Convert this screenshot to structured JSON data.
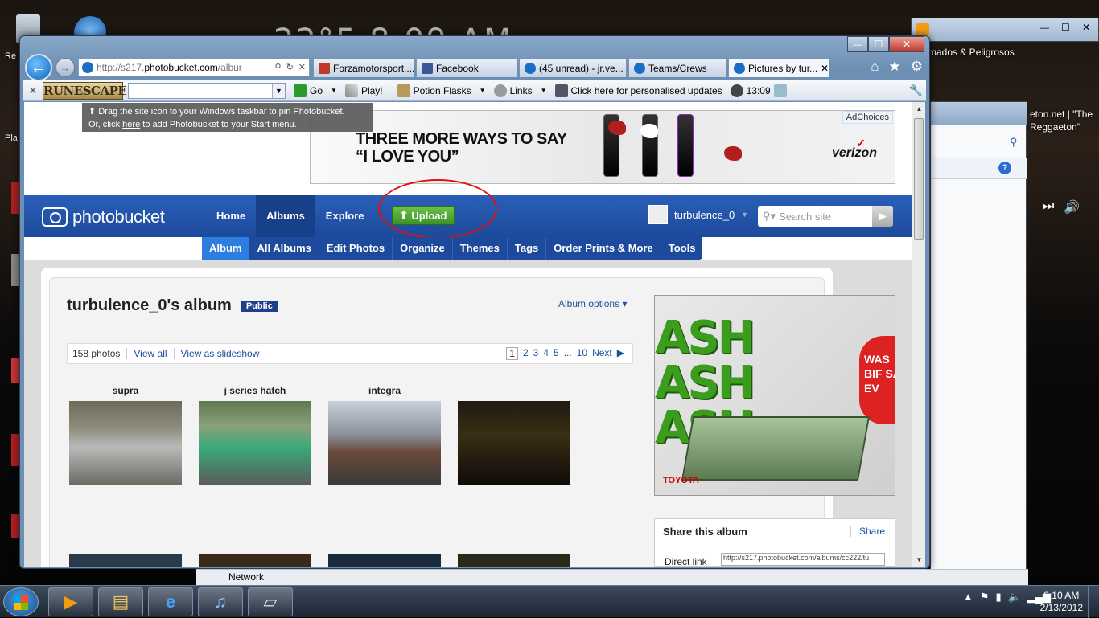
{
  "desktop": {
    "clock_text": "22°5   8:09 AM",
    "icons": [
      {
        "label": "Re",
        "name": "recycle-bin"
      },
      {
        "label": "Pla",
        "name": "player"
      }
    ]
  },
  "background_window": {
    "title_1": "rmados & Peligrosos",
    "title_2": "eton.net | \"The Reggaeton\""
  },
  "browser": {
    "address_prefix": "http://s217.",
    "address_domain": "photobucket.com",
    "address_suffix": "/albur",
    "tabs": [
      {
        "label": "Forzamotorsport....",
        "icon_color": "#c0392b"
      },
      {
        "label": "Facebook",
        "icon_color": "#3b5998"
      },
      {
        "label": "(45 unread) - jr.ve...",
        "icon_color": "#1a6ec8"
      },
      {
        "label": "Teams/Crews",
        "icon_color": "#1a6ec8"
      },
      {
        "label": "Pictures by tur...",
        "icon_color": "#1a6ec8",
        "active": true
      }
    ],
    "toolbar": {
      "logo": "RUNESCAPE",
      "go": "Go",
      "play": "Play!",
      "potion": "Potion Flasks",
      "links": "Links",
      "updates": "Click here for personalised updates",
      "time": "13:09"
    },
    "pin_tip": {
      "line1": "Drag the site icon to your Windows taskbar to pin Photobucket.",
      "line2_pre": "Or, click ",
      "line2_link": "here",
      "line2_post": " to add Photobucket to your Start menu."
    }
  },
  "ad_top": {
    "line1": "THREE MORE WAYS TO SAY",
    "line2": "“I LOVE YOU”",
    "adchoices": "AdChoices",
    "brand": "verizon"
  },
  "photobucket": {
    "logo": "photobucket",
    "nav": [
      "Home",
      "Albums",
      "Explore"
    ],
    "upload": "Upload",
    "username": "turbulence_0",
    "search_placeholder": "Search site",
    "subnav": [
      "Album",
      "All Albums",
      "Edit Photos",
      "Organize",
      "Themes",
      "Tags",
      "Order Prints & More",
      "Tools"
    ]
  },
  "album": {
    "title": "turbulence_0's album",
    "badge": "Public",
    "options": "Album options ▾",
    "count": "158 photos",
    "view_all": "View all",
    "slideshow": "View as slideshow",
    "pages": [
      "1",
      "2",
      "3",
      "4",
      "5",
      "...",
      "10"
    ],
    "next": "Next",
    "photos": [
      {
        "label": "supra"
      },
      {
        "label": "j series hatch"
      },
      {
        "label": "integra"
      },
      {
        "label": ""
      }
    ]
  },
  "side_ad": {
    "text": "ASH",
    "sub": "WAS BIF SA EV",
    "brand": "TOYOTA"
  },
  "share": {
    "title": "Share this album",
    "link": "Share",
    "direct_label": "Direct link",
    "direct_value": "http://s217.photobucket.com/albums/cc222/tu"
  },
  "taskbar": {
    "network": "Network",
    "time": "8:10 AM",
    "date": "2/13/2012"
  }
}
